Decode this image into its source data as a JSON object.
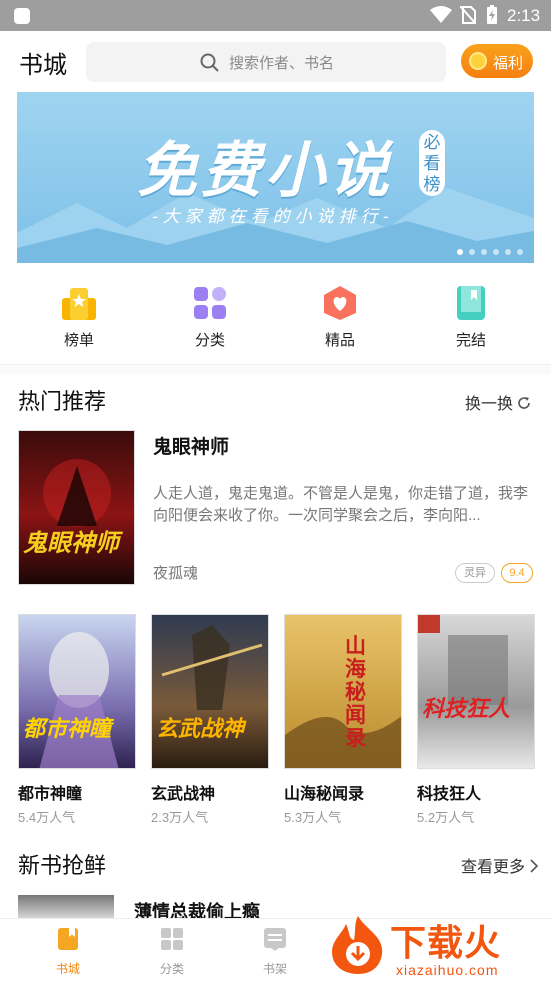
{
  "status_bar": {
    "time": "2:13"
  },
  "header": {
    "title": "书城",
    "search_placeholder": "搜索作者、书名",
    "fuli_label": "福利"
  },
  "banner": {
    "headline": "免费小说",
    "tag": "必看榜",
    "subtitle": "-大家都在看的小说排行-",
    "page_count": 6,
    "active_page": 1
  },
  "quick_nav": [
    {
      "label": "榜单",
      "icon": "ranking-icon"
    },
    {
      "label": "分类",
      "icon": "category-icon"
    },
    {
      "label": "精品",
      "icon": "boutique-icon"
    },
    {
      "label": "完结",
      "icon": "finished-icon"
    }
  ],
  "hot": {
    "title": "热门推荐",
    "refresh_label": "换一换",
    "featured": {
      "title": "鬼眼神师",
      "desc": "人走人道，鬼走鬼道。不管是人是鬼，你走错了道，我李向阳便会来收了你。一次同学聚会之后，李向阳...",
      "author": "夜孤魂",
      "genre": "灵异",
      "score": "9.4",
      "cover_text": "鬼眼神师"
    },
    "books": [
      {
        "title": "都市神瞳",
        "popularity": "5.4万人气",
        "cover_text": "都市神瞳"
      },
      {
        "title": "玄武战神",
        "popularity": "2.3万人气",
        "cover_text": "玄武战神"
      },
      {
        "title": "山海秘闻录",
        "popularity": "5.3万人气",
        "cover_text": "山海秘闻录"
      },
      {
        "title": "科技狂人",
        "popularity": "5.2万人气",
        "cover_text": "科技狂人"
      }
    ]
  },
  "new_books": {
    "title": "新书抢鲜",
    "more_label": "查看更多",
    "first_title": "薄情总裁偷上瘾"
  },
  "bottom_nav": [
    {
      "label": "书城",
      "active": true
    },
    {
      "label": "分类",
      "active": false
    },
    {
      "label": "书架",
      "active": false
    }
  ],
  "watermark": {
    "text": "下载火",
    "url": "xiazaihuo.com"
  },
  "colors": {
    "accent": "#f08a14",
    "banner_blue": "#8ccbed"
  }
}
